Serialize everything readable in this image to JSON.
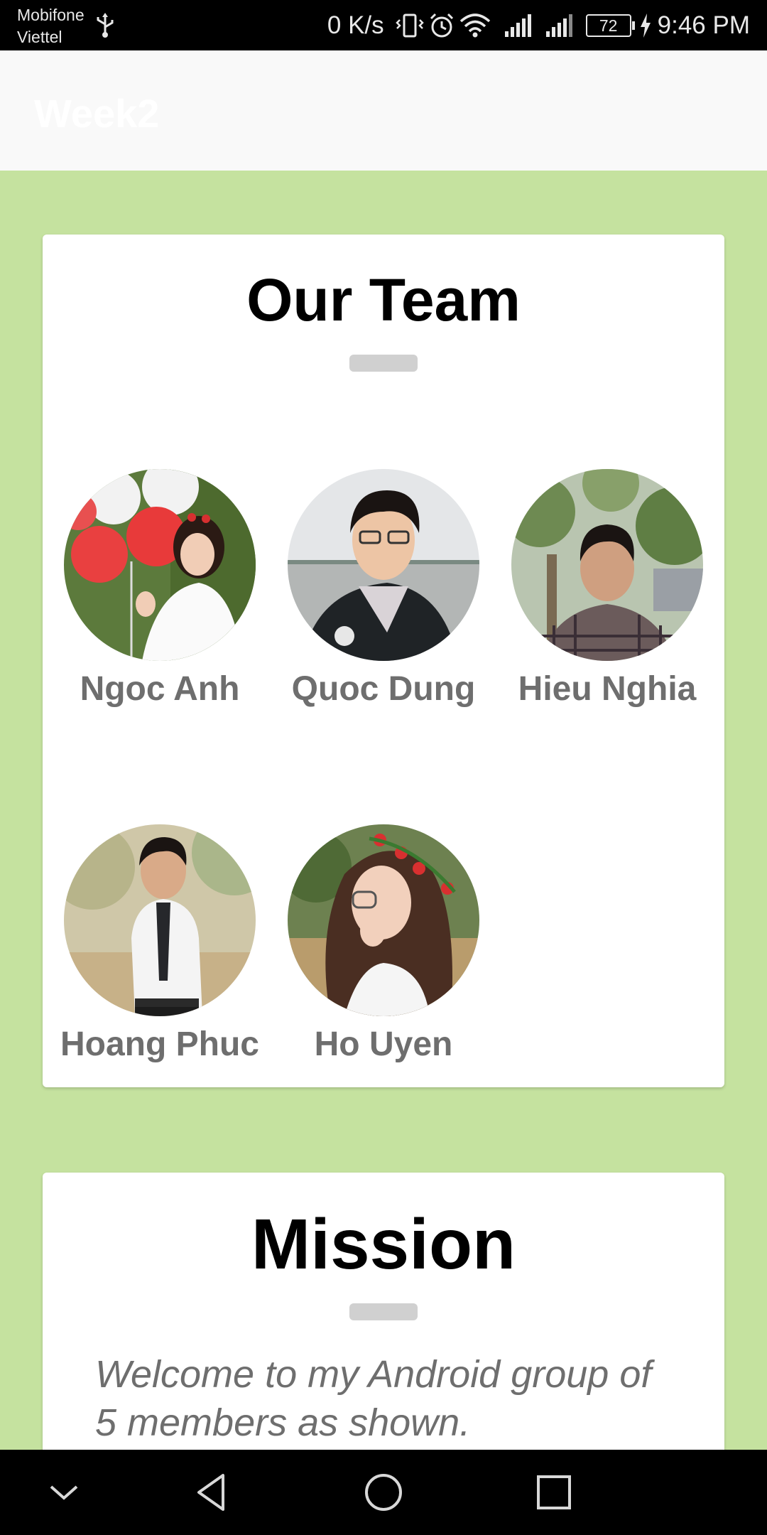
{
  "status_bar": {
    "carrier_1": "Mobifone",
    "carrier_2": "Viettel",
    "net_speed": "0 K/s",
    "battery": "72",
    "time": "9:46 PM",
    "icons": [
      "usb-icon",
      "vibrate-icon",
      "alarm-icon",
      "wifi-icon",
      "signal-icon",
      "signal-icon",
      "battery-icon",
      "charging-icon"
    ]
  },
  "app_bar": {
    "title": "Week2"
  },
  "team_card": {
    "title": "Our Team",
    "members": [
      {
        "name": "Ngoc Anh"
      },
      {
        "name": "Quoc Dung"
      },
      {
        "name": "Hieu Nghia"
      },
      {
        "name": "Hoang Phuc"
      },
      {
        "name": "Ho Uyen"
      }
    ]
  },
  "mission_card": {
    "title": "Mission",
    "text": "Welcome to my Android group of 5 members as shown."
  },
  "nav_bar": {
    "icons": [
      "collapse-icon",
      "back-icon",
      "home-icon",
      "recents-icon"
    ]
  },
  "colors": {
    "background": "#c5e29f",
    "card": "#ffffff",
    "app_bar": "#f9f9f9",
    "name_text": "#6e6e6e",
    "divider": "#d0d0d0"
  }
}
